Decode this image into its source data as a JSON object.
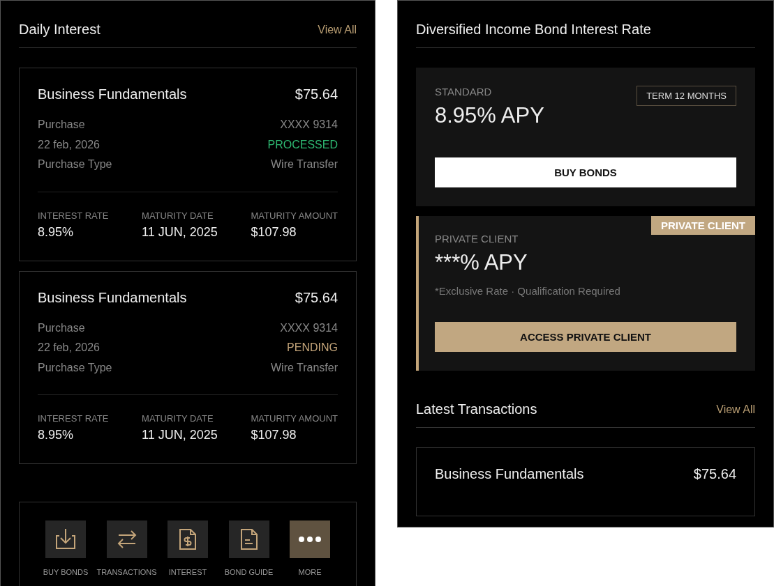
{
  "daily_interest": {
    "title": "Daily Interest",
    "view_all": "View All",
    "transactions": [
      {
        "name": "Business Fundamentals",
        "amount": "$75.64",
        "purchase_label": "Purchase",
        "account": "XXXX 9314",
        "date": "22 feb, 2026",
        "status": {
          "text": "PROCESSED",
          "kind": "processed"
        },
        "type_label": "Purchase Type",
        "type_value": "Wire Transfer",
        "stats": [
          {
            "label": "INTEREST RATE",
            "value": "8.95%"
          },
          {
            "label": "MATURITY DATE",
            "value": "11 JUN, 2025"
          },
          {
            "label": "MATURITY AMOUNT",
            "value": "$107.98"
          }
        ]
      },
      {
        "name": "Business Fundamentals",
        "amount": "$75.64",
        "purchase_label": "Purchase",
        "account": "XXXX 9314",
        "date": "22 feb, 2026",
        "status": {
          "text": "PENDING",
          "kind": "pending"
        },
        "type_label": "Purchase Type",
        "type_value": "Wire Transfer",
        "stats": [
          {
            "label": "INTEREST RATE",
            "value": "8.95%"
          },
          {
            "label": "MATURITY DATE",
            "value": "11 JUN, 2025"
          },
          {
            "label": "MATURITY AMOUNT",
            "value": "$107.98"
          }
        ]
      }
    ],
    "quick_actions": [
      {
        "label": "BUY BONDS",
        "kind": "download"
      },
      {
        "label": "TRANSACTIONS",
        "kind": "transfer"
      },
      {
        "label": "INTEREST",
        "kind": "statement"
      },
      {
        "label": "BOND GUIDE",
        "kind": "document"
      },
      {
        "label": "MORE",
        "kind": "more"
      }
    ]
  },
  "interest_rate": {
    "title": "Diversified Income Bond Interest Rate",
    "standard": {
      "label": "STANDARD",
      "rate": "8.95% APY",
      "term": "TERM 12 MONTHS",
      "button": "BUY BONDS"
    },
    "private": {
      "badge": "PRIVATE CLIENT",
      "label": "PRIVATE CLIENT",
      "rate": "***% APY",
      "note": "*Exclusive Rate · Qualification Required",
      "button": "ACCESS PRIVATE CLIENT"
    }
  },
  "latest_transactions": {
    "title": "Latest Transactions",
    "view_all": "View All",
    "transactions": [
      {
        "name": "Business Fundamentals",
        "amount": "$75.64"
      }
    ]
  }
}
